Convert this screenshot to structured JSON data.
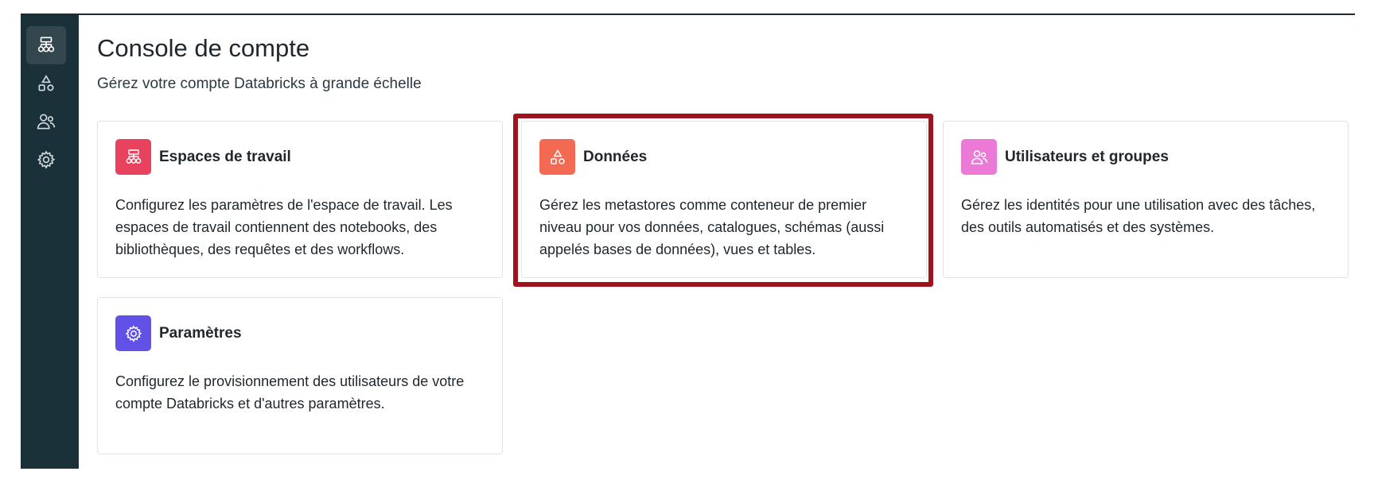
{
  "header": {
    "title": "Console de compte",
    "subtitle": "Gérez votre compte Databricks à grande échelle"
  },
  "sidebar": {
    "items": [
      {
        "icon": "workspaces-icon",
        "active": true
      },
      {
        "icon": "data-icon",
        "active": false
      },
      {
        "icon": "users-icon",
        "active": false
      },
      {
        "icon": "gear-icon",
        "active": false
      }
    ]
  },
  "cards": [
    {
      "title": "Espaces de travail",
      "description": "Configurez les paramètres de l'espace de travail. Les espaces de travail contiennent des notebooks, des bibliothèques, des requêtes et des workflows.",
      "icon": "workspaces-icon",
      "icon_color": "#e8425f"
    },
    {
      "title": "Données",
      "description": "Gérez les metastores comme conteneur de premier niveau pour vos données, catalogues, schémas (aussi appelés bases de données), vues et tables.",
      "icon": "data-icon",
      "icon_color": "#f26a52",
      "highlighted": true
    },
    {
      "title": "Utilisateurs et groupes",
      "description": "Gérez les identités pour une utilisation avec des tâches, des outils automatisés et des systèmes.",
      "icon": "users-icon",
      "icon_color": "#ea7ad6"
    },
    {
      "title": "Paramètres",
      "description": "Configurez le provisionnement des utilisateurs de votre compte Databricks et d'autres paramètres.",
      "icon": "gear-icon",
      "icon_color": "#6151e6"
    }
  ],
  "colors": {
    "sidebar_bg": "#1b3139",
    "sidebar_active": "#34474f",
    "highlight_frame": "#a0121d",
    "card_border": "#dfe3e6"
  }
}
